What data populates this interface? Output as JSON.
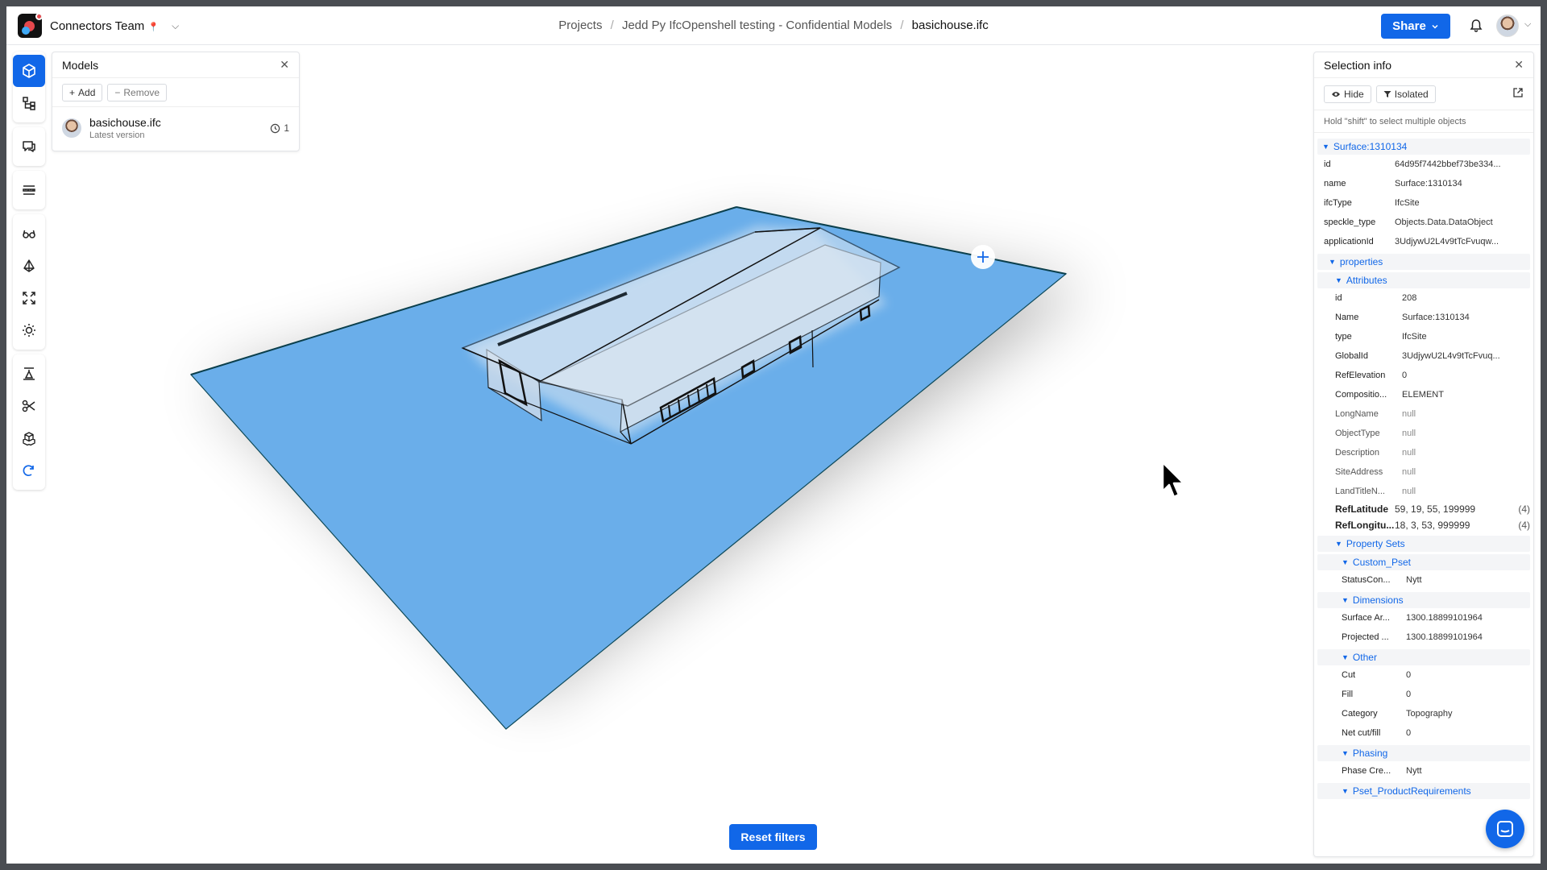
{
  "header": {
    "team_name": "Connectors Team",
    "team_emoji": "📍",
    "breadcrumb": [
      "Projects",
      "Jedd Py IfcOpenshell testing - Confidential Models",
      "basichouse.ifc"
    ],
    "share_label": "Share"
  },
  "models_panel": {
    "title": "Models",
    "add_label": "Add",
    "remove_label": "Remove",
    "model_name": "basichouse.ifc",
    "model_version": "Latest version",
    "version_count": "1"
  },
  "selection": {
    "title": "Selection info",
    "hide_label": "Hide",
    "isolated_label": "Isolated",
    "hint": "Hold \"shift\" to select multiple objects",
    "root": "Surface:1310134",
    "root_props": [
      {
        "k": "id",
        "v": "64d95f7442bbef73be334..."
      },
      {
        "k": "name",
        "v": "Surface:1310134"
      },
      {
        "k": "ifcType",
        "v": "IfcSite"
      },
      {
        "k": "speckle_type",
        "v": "Objects.Data.DataObject"
      },
      {
        "k": "applicationId",
        "v": "3UdjywU2L4v9tTcFvuqw..."
      }
    ],
    "properties_label": "properties",
    "attributes_label": "Attributes",
    "attributes": [
      {
        "k": "id",
        "v": "208"
      },
      {
        "k": "Name",
        "v": "Surface:1310134"
      },
      {
        "k": "type",
        "v": "IfcSite"
      },
      {
        "k": "GlobalId",
        "v": "3UdjywU2L4v9tTcFvuq..."
      },
      {
        "k": "RefElevation",
        "v": "0"
      },
      {
        "k": "Compositio...",
        "v": "ELEMENT"
      },
      {
        "k": "LongName",
        "v": "null"
      },
      {
        "k": "ObjectType",
        "v": "null"
      },
      {
        "k": "Description",
        "v": "null"
      },
      {
        "k": "SiteAddress",
        "v": "null"
      },
      {
        "k": "LandTitleN...",
        "v": "null"
      }
    ],
    "ref_latitude": {
      "k": "RefLatitude",
      "v": "59, 19, 55, 199999",
      "c": "(4)"
    },
    "ref_longitude": {
      "k": "RefLongitu...",
      "v": "18, 3, 53, 999999",
      "c": "(4)"
    },
    "property_sets_label": "Property Sets",
    "custom_pset_label": "Custom_Pset",
    "custom_pset": [
      {
        "k": "StatusCon...",
        "v": "Nytt"
      }
    ],
    "dimensions_label": "Dimensions",
    "dimensions": [
      {
        "k": "Surface Ar...",
        "v": "1300.18899101964"
      },
      {
        "k": "Projected ...",
        "v": "1300.18899101964"
      }
    ],
    "other_label": "Other",
    "other": [
      {
        "k": "Cut",
        "v": "0"
      },
      {
        "k": "Fill",
        "v": "0"
      },
      {
        "k": "Category",
        "v": "Topography"
      },
      {
        "k": "Net cut/fill",
        "v": "0"
      }
    ],
    "phasing_label": "Phasing",
    "phasing": [
      {
        "k": "Phase Cre...",
        "v": "Nytt"
      }
    ],
    "pset_product_label": "Pset_ProductRequirements"
  },
  "viewer": {
    "reset_filters_label": "Reset filters",
    "site_color": "#6aaeea"
  },
  "colors": {
    "accent": "#1167e8"
  }
}
